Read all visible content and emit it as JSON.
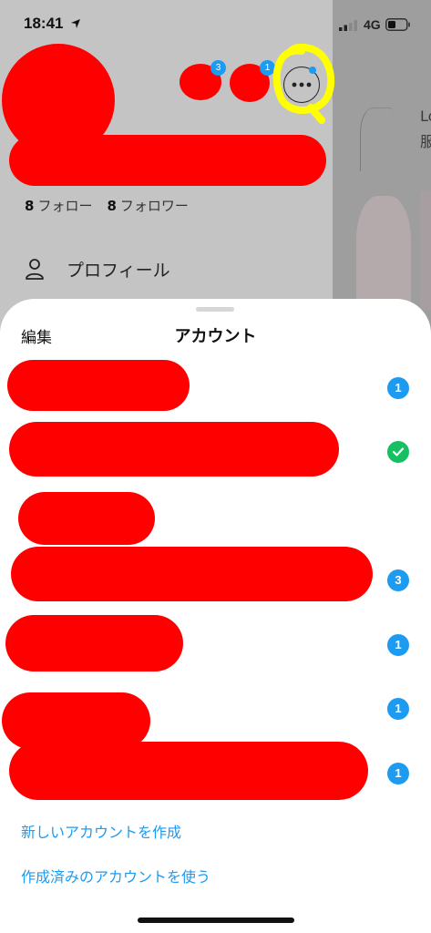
{
  "status_bar": {
    "time": "18:41",
    "network": "4G"
  },
  "header": {
    "badges": [
      "3",
      "1"
    ],
    "follow": {
      "following_count": "8",
      "following_label": "フォロー",
      "followers_count": "8",
      "followers_label": "フォロワー"
    }
  },
  "drawer_menu": {
    "profile_label": "プロフィール"
  },
  "feed_peek": {
    "text_1": "Lo",
    "text_2": "服"
  },
  "sheet": {
    "edit_label": "編集",
    "title": "アカウント",
    "accounts": [
      {
        "indicator": "badge",
        "badge": "1"
      },
      {
        "indicator": "check"
      },
      {
        "indicator": "none"
      },
      {
        "indicator": "badge",
        "badge": "3"
      },
      {
        "indicator": "badge",
        "badge": "1"
      },
      {
        "indicator": "badge",
        "badge": "1"
      },
      {
        "indicator": "badge",
        "badge": "1"
      }
    ],
    "create_account": "新しいアカウントを作成",
    "use_existing": "作成済みのアカウントを使う"
  },
  "colors": {
    "accent": "#1d9bf0",
    "check": "#17bf63",
    "redaction": "#ff0000",
    "annotation": "#ffff00"
  }
}
